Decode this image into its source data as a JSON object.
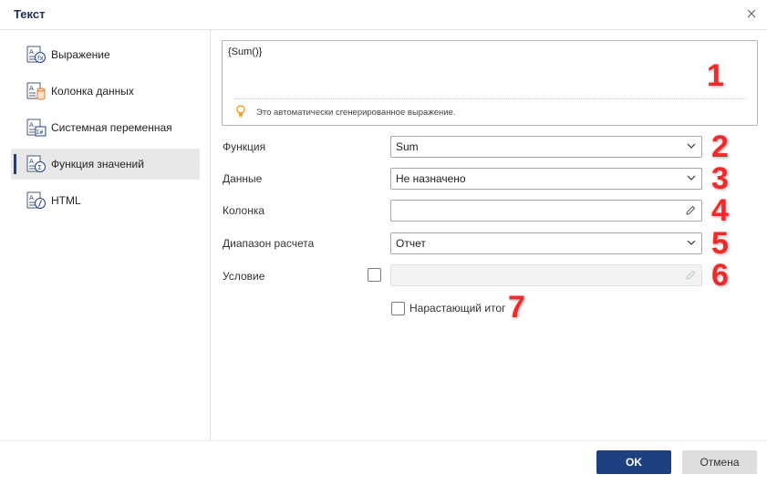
{
  "dialog": {
    "title": "Текст"
  },
  "sidebar": {
    "items": [
      {
        "label": "Выражение",
        "icon": "expression-icon"
      },
      {
        "label": "Колонка данных",
        "icon": "data-column-icon"
      },
      {
        "label": "Системная переменная",
        "icon": "system-variable-icon"
      },
      {
        "label": "Функция значений",
        "icon": "summary-function-icon",
        "active": true
      },
      {
        "label": "HTML",
        "icon": "html-icon"
      }
    ]
  },
  "expression": {
    "value": "{Sum()}",
    "hint": "Это автоматически сгенерированное выражение."
  },
  "form": {
    "function": {
      "label": "Функция",
      "value": "Sum"
    },
    "data": {
      "label": "Данные",
      "value": "Не назначено"
    },
    "column": {
      "label": "Колонка",
      "value": ""
    },
    "range": {
      "label": "Диапазон расчета",
      "value": "Отчет"
    },
    "condition": {
      "label": "Условие",
      "value": ""
    },
    "running_total": {
      "label": "Нарастающий итог"
    }
  },
  "annotations": [
    "1",
    "2",
    "3",
    "4",
    "5",
    "6",
    "7"
  ],
  "buttons": {
    "ok": "OK",
    "cancel": "Отмена"
  },
  "colors": {
    "accent": "#1e3f80",
    "annotation": "#ee2a2a",
    "hint_bulb": "#f0a020"
  }
}
